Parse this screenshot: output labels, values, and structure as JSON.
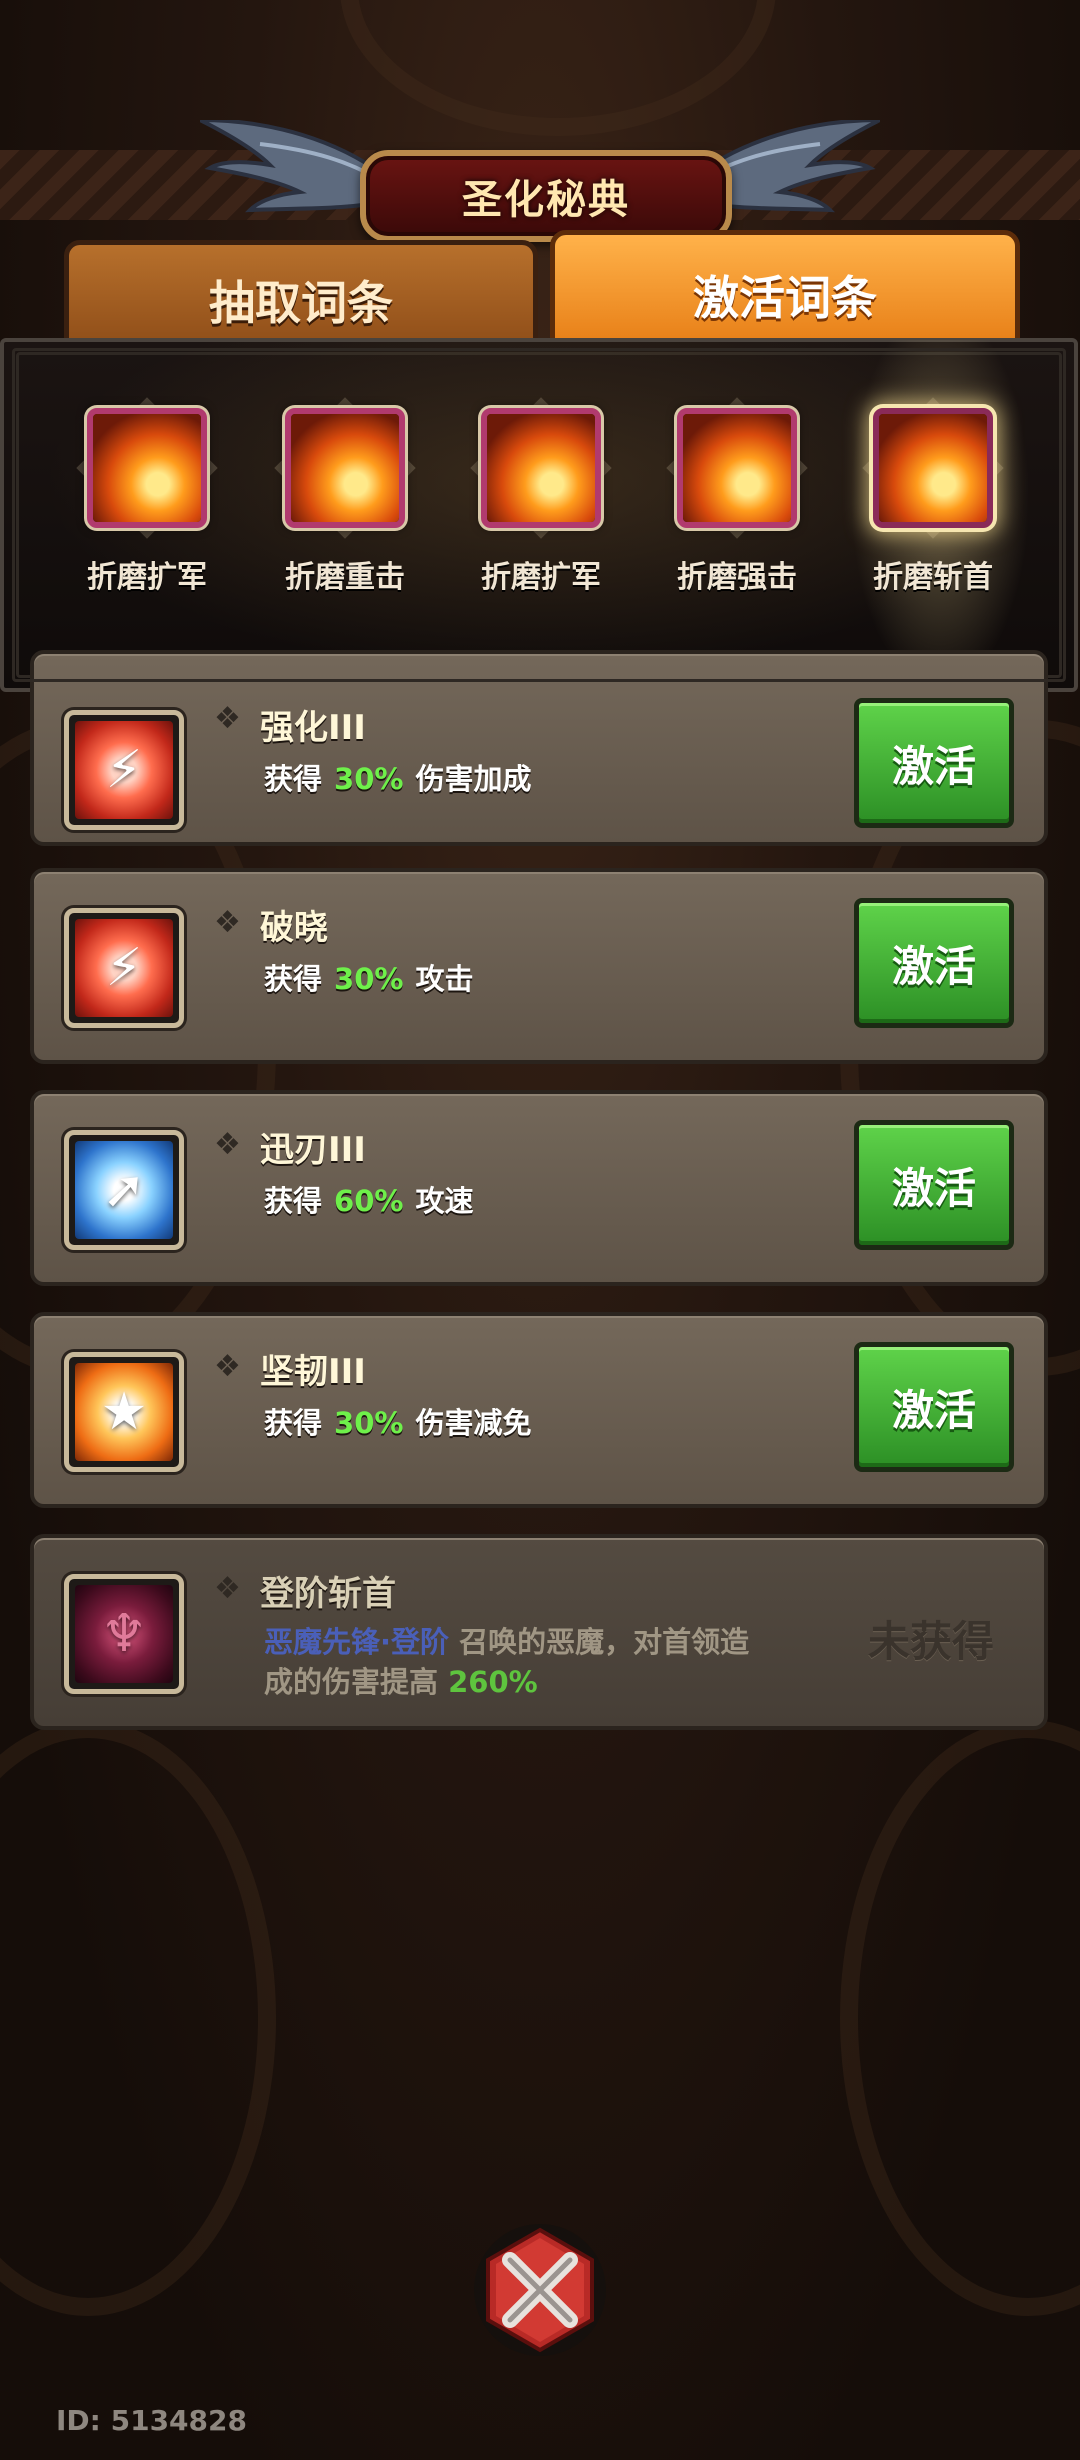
{
  "title": "圣化秘典",
  "tabs": {
    "draw": "抽取词条",
    "activate": "激活词条"
  },
  "slots": [
    {
      "label": "折磨扩军",
      "icon": "fire-skill-icon",
      "selected": false
    },
    {
      "label": "折磨重击",
      "icon": "fire-skill-icon",
      "selected": false
    },
    {
      "label": "折磨扩军",
      "icon": "fire-skill-icon",
      "selected": false
    },
    {
      "label": "折磨强击",
      "icon": "fire-skill-icon",
      "selected": false
    },
    {
      "label": "折磨斩首",
      "icon": "fire-skill-icon",
      "selected": true
    }
  ],
  "rows": [
    {
      "name": "强化III",
      "prefix": "获得",
      "value": "30%",
      "suffix": "伤害加成",
      "button": "激活",
      "icon": "red-burst-icon"
    },
    {
      "name": "破晓",
      "prefix": "获得",
      "value": "30%",
      "suffix": "攻击",
      "button": "激活",
      "icon": "red-burst-icon"
    },
    {
      "name": "迅刃III",
      "prefix": "获得",
      "value": "60%",
      "suffix": "攻速",
      "button": "激活",
      "icon": "blue-arrow-icon"
    },
    {
      "name": "坚韧III",
      "prefix": "获得",
      "value": "30%",
      "suffix": "伤害减免",
      "button": "激活",
      "icon": "shield-star-icon"
    }
  ],
  "locked_row": {
    "name": "登阶斩首",
    "highlight": "恶魔先锋·登阶",
    "text1": " 召唤的恶魔，对首领造",
    "text2": "成的伤害提高 ",
    "value": "260%",
    "status": "未获得",
    "icon": "demon-icon"
  },
  "uid": "ID: 5134828",
  "colors": {
    "percent_green": "#6ef04a",
    "button_green": "#3fae34",
    "tab_active": "#f39a2a",
    "title_red": "#5a0f0d"
  }
}
